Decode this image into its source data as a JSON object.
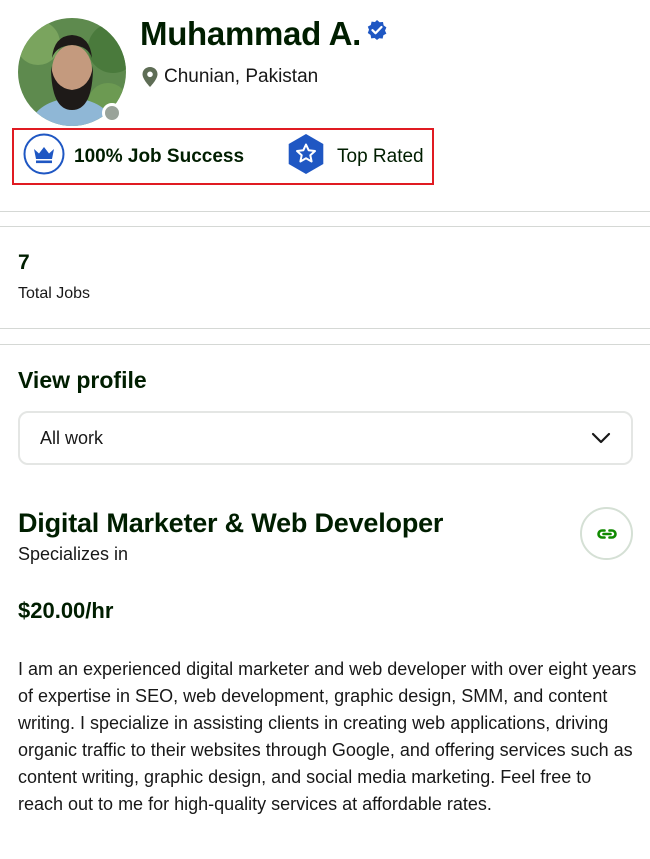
{
  "profile": {
    "name": "Muhammad A.",
    "location": "Chunian, Pakistan",
    "avatar_alt": "profile photo",
    "online_status": "offline"
  },
  "badges": {
    "job_success": "100% Job Success",
    "top_rated": "Top Rated"
  },
  "stats": {
    "total_jobs_value": "7",
    "total_jobs_label": "Total Jobs"
  },
  "view_profile": {
    "heading": "View profile",
    "selected_option": "All work"
  },
  "specialization": {
    "title": "Digital Marketer & Web Developer",
    "subtitle": "Specializes in",
    "rate": "$20.00/hr",
    "bio": "I am an experienced digital marketer and web developer with over eight years of expertise in SEO, web development, graphic design, SMM, and content writing. I specialize in assisting clients in creating web applications, driving organic traffic to their websites through Google, and offering services such as content writing, graphic design, and social media marketing. Feel free to reach out to me for high-quality services at affordable rates."
  },
  "icons": {
    "verified": "verified-badge-icon",
    "location": "map-pin-icon",
    "job_success": "crown-icon",
    "top_rated": "star-hexagon-icon",
    "dropdown": "chevron-down-icon",
    "copy_link": "link-icon"
  },
  "colors": {
    "brand_green": "#14a800",
    "dark_text": "#001e00",
    "badge_blue": "#1f57c3",
    "highlight_red": "#e01b22",
    "status_gray": "#9aa39a"
  }
}
